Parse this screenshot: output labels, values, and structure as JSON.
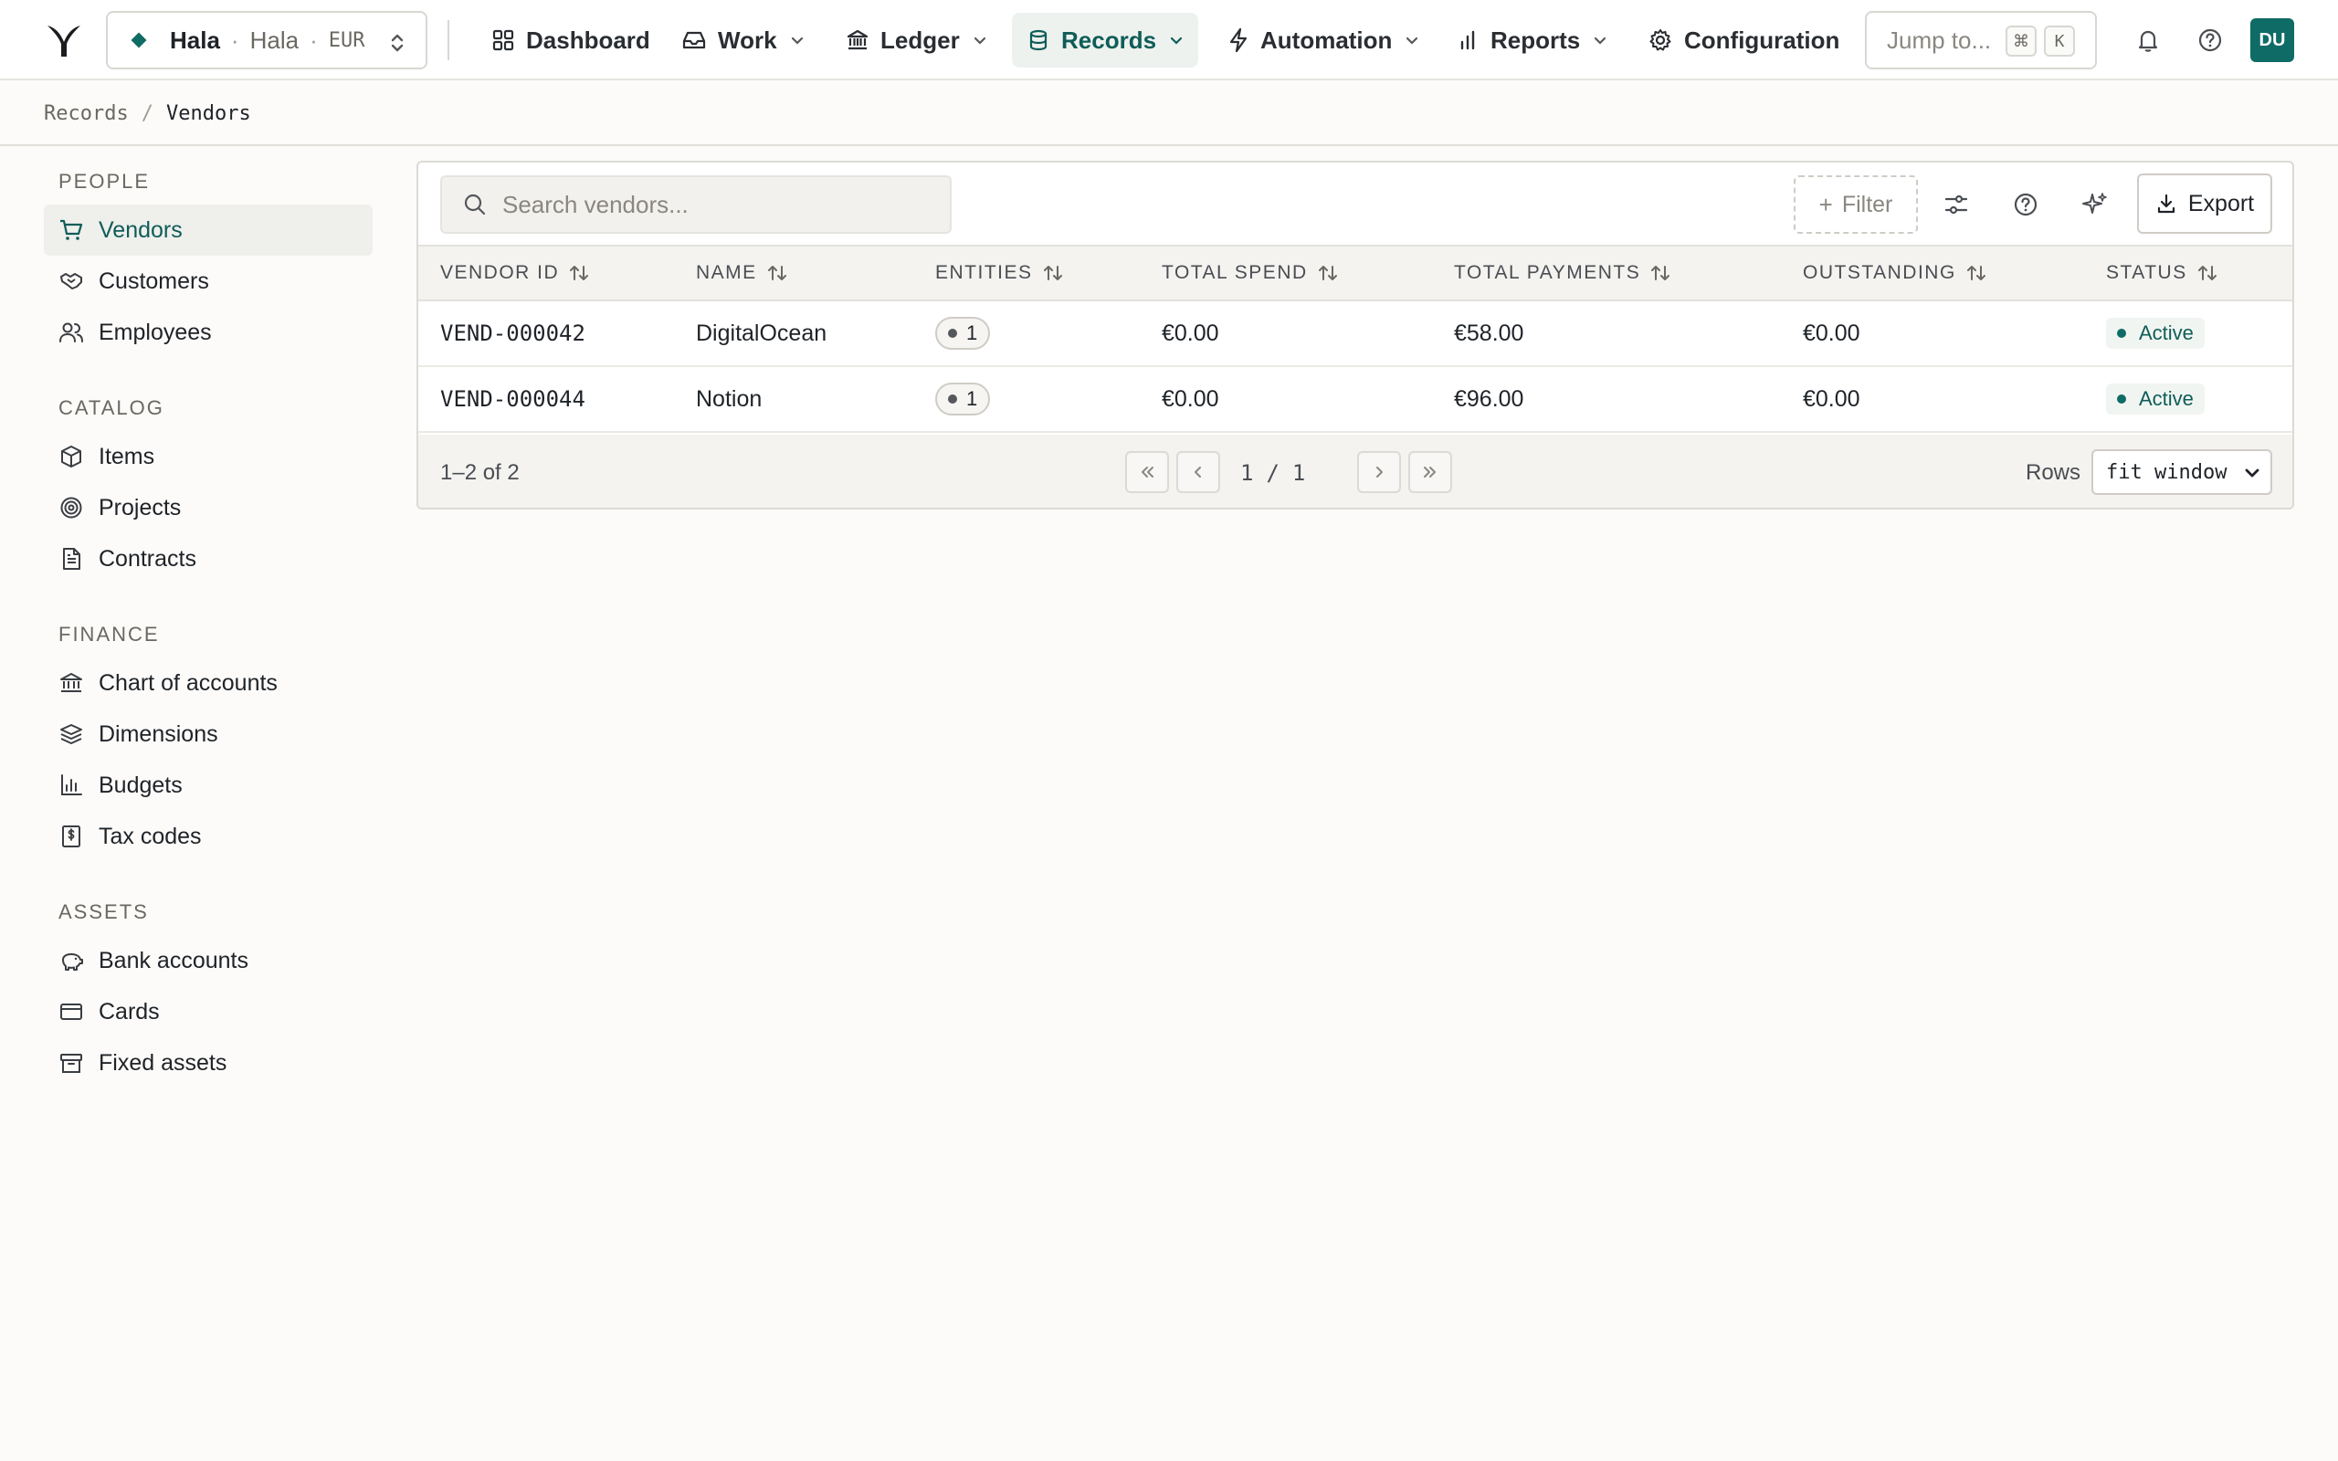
{
  "topbar": {
    "entity": {
      "name": "Hala",
      "sub": "Hala",
      "currency": "EUR"
    },
    "nav": [
      {
        "label": "Dashboard",
        "icon": "grid-icon",
        "dropdown": false,
        "active": false
      },
      {
        "label": "Work",
        "icon": "inbox-icon",
        "dropdown": true,
        "active": false
      },
      {
        "label": "Ledger",
        "icon": "bank-icon",
        "dropdown": true,
        "active": false
      },
      {
        "label": "Records",
        "icon": "database-icon",
        "dropdown": true,
        "active": true
      },
      {
        "label": "Automation",
        "icon": "bolt-icon",
        "dropdown": true,
        "active": false
      },
      {
        "label": "Reports",
        "icon": "bar-chart-icon",
        "dropdown": true,
        "active": false
      },
      {
        "label": "Configuration",
        "icon": "gear-icon",
        "dropdown": false,
        "active": false
      }
    ],
    "jump": {
      "placeholder": "Jump to...",
      "key1": "⌘",
      "key2": "K"
    },
    "avatar": "DU"
  },
  "breadcrumb": {
    "parent": "Records",
    "separator": "/",
    "current": "Vendors"
  },
  "sidebar": {
    "sections": [
      {
        "title": "PEOPLE",
        "items": [
          {
            "label": "Vendors",
            "icon": "cart-icon",
            "active": true
          },
          {
            "label": "Customers",
            "icon": "handshake-icon",
            "active": false
          },
          {
            "label": "Employees",
            "icon": "users-icon",
            "active": false
          }
        ]
      },
      {
        "title": "CATALOG",
        "items": [
          {
            "label": "Items",
            "icon": "box-icon",
            "active": false
          },
          {
            "label": "Projects",
            "icon": "target-icon",
            "active": false
          },
          {
            "label": "Contracts",
            "icon": "document-icon",
            "active": false
          }
        ]
      },
      {
        "title": "FINANCE",
        "items": [
          {
            "label": "Chart of accounts",
            "icon": "bank-icon",
            "active": false
          },
          {
            "label": "Dimensions",
            "icon": "layers-icon",
            "active": false
          },
          {
            "label": "Budgets",
            "icon": "bar-chart-icon",
            "active": false
          },
          {
            "label": "Tax codes",
            "icon": "receipt-icon",
            "active": false
          }
        ]
      },
      {
        "title": "ASSETS",
        "items": [
          {
            "label": "Bank accounts",
            "icon": "piggy-bank-icon",
            "active": false
          },
          {
            "label": "Cards",
            "icon": "credit-card-icon",
            "active": false
          },
          {
            "label": "Fixed assets",
            "icon": "archive-icon",
            "active": false
          }
        ]
      }
    ]
  },
  "toolbar": {
    "search_placeholder": "Search vendors...",
    "filter_label": "Filter",
    "export_label": "Export"
  },
  "table": {
    "columns": [
      "VENDOR ID",
      "NAME",
      "ENTITIES",
      "TOTAL SPEND",
      "TOTAL PAYMENTS",
      "OUTSTANDING",
      "STATUS"
    ],
    "rows": [
      {
        "vendor_id": "VEND-000042",
        "name": "DigitalOcean",
        "entities": "1",
        "total_spend": "€0.00",
        "total_payments": "€58.00",
        "outstanding": "€0.00",
        "status": "Active"
      },
      {
        "vendor_id": "VEND-000044",
        "name": "Notion",
        "entities": "1",
        "total_spend": "€0.00",
        "total_payments": "€96.00",
        "outstanding": "€0.00",
        "status": "Active"
      }
    ]
  },
  "pagination": {
    "range": "1–2 of 2",
    "page": "1",
    "of": "/",
    "total_pages": "1",
    "rows_label": "Rows",
    "rows_value": "fit window"
  },
  "colors": {
    "accent": "#0f6b66",
    "accent_text": "#0f5d58",
    "background": "#fcfbf9"
  }
}
